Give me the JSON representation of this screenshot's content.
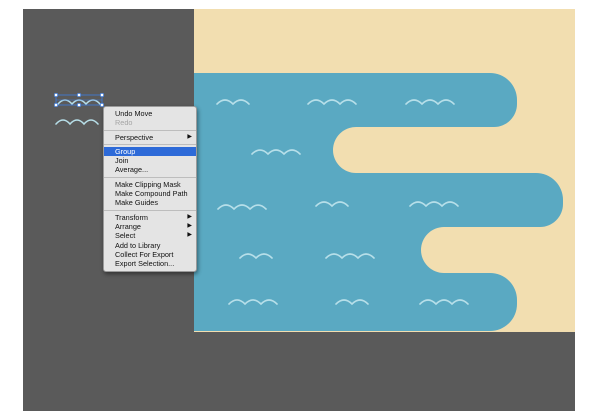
{
  "colors": {
    "frame_bg": "#5a5a5a",
    "sand": "#f2deb0",
    "water": "#5aa9c2",
    "wave": "#b7dfe9",
    "selection": "#3d7de3",
    "menu_bg": "#e4e4e4",
    "menu_highlight": "#2d6ad8"
  },
  "context_menu": {
    "items": [
      {
        "label": "Undo Move",
        "enabled": true
      },
      {
        "label": "Redo",
        "enabled": false
      },
      {
        "separator": true
      },
      {
        "label": "Perspective",
        "submenu": true
      },
      {
        "separator": true
      },
      {
        "label": "Group",
        "selected": true
      },
      {
        "label": "Join"
      },
      {
        "label": "Average..."
      },
      {
        "separator": true
      },
      {
        "label": "Make Clipping Mask"
      },
      {
        "label": "Make Compound Path"
      },
      {
        "label": "Make Guides"
      },
      {
        "separator": true
      },
      {
        "label": "Transform",
        "submenu": true
      },
      {
        "label": "Arrange",
        "submenu": true
      },
      {
        "label": "Select",
        "submenu": true
      },
      {
        "label": "Add to Library"
      },
      {
        "label": "Collect For Export"
      },
      {
        "label": "Export Selection..."
      }
    ],
    "submenu_icon": "triangle-right-icon"
  },
  "icons": {
    "wave": "wave-icon",
    "selected_wave_group": "selected-wave-icon"
  }
}
